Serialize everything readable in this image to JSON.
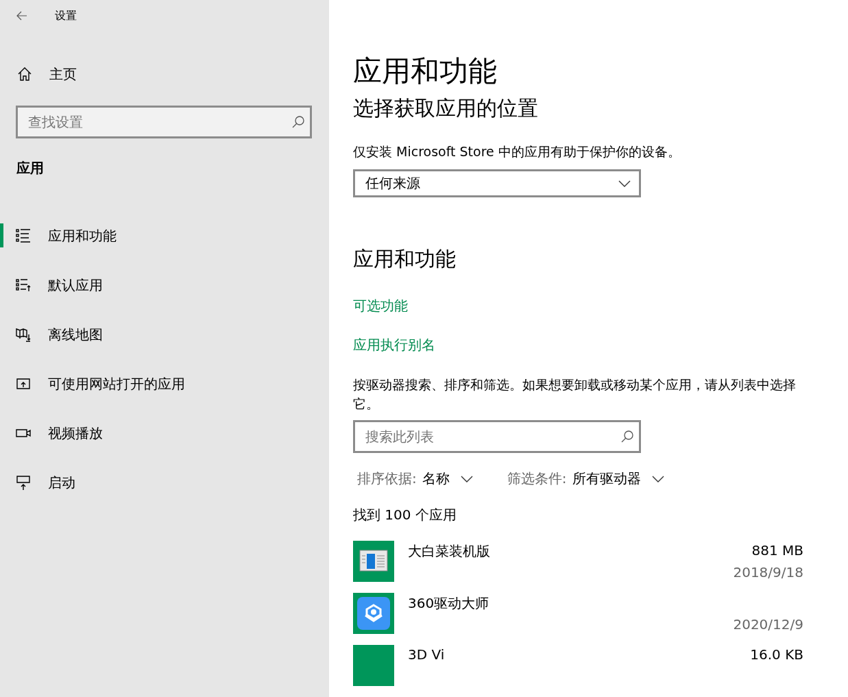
{
  "window": {
    "title": "设置"
  },
  "sidebar": {
    "home": "主页",
    "search": {
      "placeholder": "查找设置"
    },
    "section": "应用",
    "items": [
      {
        "label": "应用和功能",
        "kind": "list",
        "selected": true
      },
      {
        "label": "默认应用",
        "kind": "defaults",
        "selected": false
      },
      {
        "label": "离线地图",
        "kind": "map",
        "selected": false
      },
      {
        "label": "可使用网站打开的应用",
        "kind": "web",
        "selected": false
      },
      {
        "label": "视频播放",
        "kind": "video",
        "selected": false
      },
      {
        "label": "启动",
        "kind": "startup",
        "selected": false
      }
    ]
  },
  "main": {
    "title": "应用和功能",
    "source_heading": "选择获取应用的位置",
    "source_note": "仅安装 Microsoft Store 中的应用有助于保护你的设备。",
    "source_dropdown": "任何来源",
    "apps_heading": "应用和功能",
    "links": [
      "可选功能",
      "应用执行别名"
    ],
    "filter_note": "按驱动器搜索、排序和筛选。如果想要卸载或移动某个应用，请从列表中选择它。",
    "list_search": {
      "placeholder": "搜索此列表"
    },
    "sort": {
      "label": "排序依据:",
      "value": "名称"
    },
    "filter": {
      "label": "筛选条件:",
      "value": "所有驱动器"
    },
    "count": "找到 100 个应用",
    "apps": [
      {
        "name": "大白菜装机版",
        "size": "881 MB",
        "date": "2018/9/18",
        "kind": "installer"
      },
      {
        "name": "360驱动大师",
        "date": "2020/12/9",
        "kind": "driver"
      },
      {
        "name": "3D Vi",
        "size": "16.0 KB",
        "kind": "viewer"
      }
    ]
  }
}
